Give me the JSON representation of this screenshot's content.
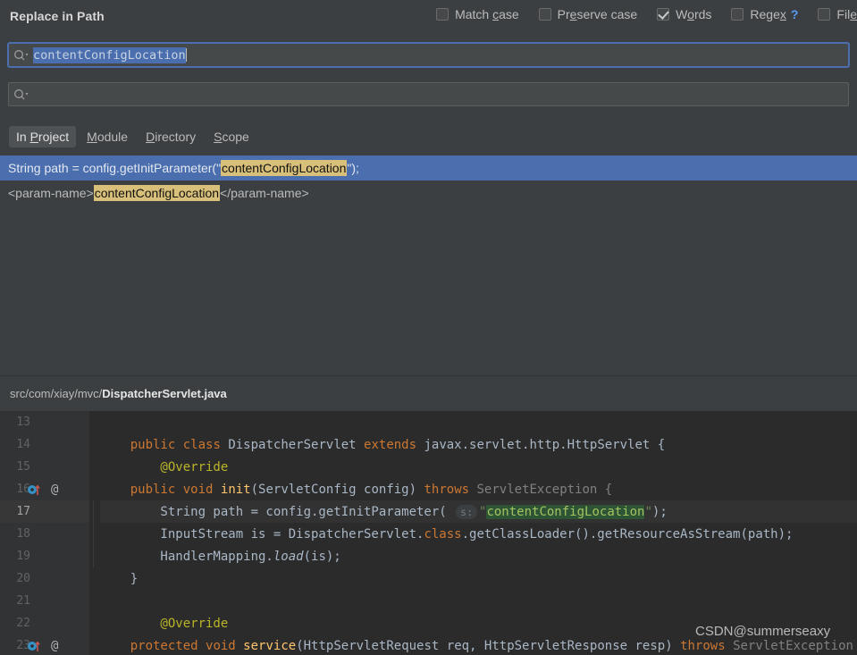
{
  "dialog": {
    "title": "Replace in Path"
  },
  "options": [
    {
      "id": "match-case",
      "label_pre": "Match ",
      "label_mn": "c",
      "label_post": "ase",
      "checked": false,
      "help": null
    },
    {
      "id": "preserve-case",
      "label_pre": "Pr",
      "label_mn": "e",
      "label_post": "serve case",
      "checked": false,
      "help": null
    },
    {
      "id": "words",
      "label_pre": "W",
      "label_mn": "o",
      "label_post": "rds",
      "checked": true,
      "help": null
    },
    {
      "id": "regex",
      "label_pre": "Rege",
      "label_mn": "x",
      "label_post": "",
      "checked": false,
      "help": "?"
    },
    {
      "id": "file-mask",
      "label_pre": "Fil",
      "label_mn": "e",
      "label_post": "",
      "checked": false,
      "help": null
    }
  ],
  "search_field": {
    "value": "contentConfigLocation",
    "placeholder": "",
    "icon": "search-icon",
    "selected": true
  },
  "replace_field": {
    "value": "",
    "placeholder": "",
    "icon": "search-icon"
  },
  "scopes": [
    {
      "id": "in-project",
      "pre": "In ",
      "mn": "P",
      "post": "roject",
      "active": true
    },
    {
      "id": "module",
      "pre": "",
      "mn": "M",
      "post": "odule",
      "active": false
    },
    {
      "id": "directory",
      "pre": "",
      "mn": "D",
      "post": "irectory",
      "active": false
    },
    {
      "id": "scope",
      "pre": "",
      "mn": "S",
      "post": "cope",
      "active": false
    }
  ],
  "results": [
    {
      "selected": true,
      "before": "String path = config.getInitParameter(\"",
      "match": "contentConfigLocation",
      "after": "\");"
    },
    {
      "selected": false,
      "before": "<param-name>",
      "match": "contentConfigLocation",
      "after": "</param-name>"
    }
  ],
  "file_path": {
    "dir": "src/com/xiay/mvc/",
    "file": "DispatcherServlet.java"
  },
  "editor": {
    "lines": [
      {
        "num": "13",
        "current": false,
        "marker": false,
        "fold": false
      },
      {
        "num": "14",
        "current": false,
        "marker": false,
        "fold": false
      },
      {
        "num": "15",
        "current": false,
        "marker": false,
        "fold": false
      },
      {
        "num": "16",
        "current": false,
        "marker": true,
        "fold": false
      },
      {
        "num": "17",
        "current": true,
        "marker": false,
        "fold": true
      },
      {
        "num": "18",
        "current": false,
        "marker": false,
        "fold": true
      },
      {
        "num": "19",
        "current": false,
        "marker": false,
        "fold": true
      },
      {
        "num": "20",
        "current": false,
        "marker": false,
        "fold": false
      },
      {
        "num": "21",
        "current": false,
        "marker": false,
        "fold": false
      },
      {
        "num": "22",
        "current": false,
        "marker": false,
        "fold": false
      },
      {
        "num": "23",
        "current": false,
        "marker": true,
        "fold": false
      }
    ],
    "code_text": {
      "l14": "public class DispatcherServlet extends javax.servlet.http.HttpServlet {",
      "l15": "@Override",
      "l16": "public void init(ServletConfig config) throws ServletException {",
      "l17_pre": "String path = config.getInitParameter( ",
      "l17_hint": "s:",
      "l17_match": "contentConfigLocation",
      "l17_post": "\");",
      "l18": "InputStream is = DispatcherServlet.class.getClassLoader().getResourceAsStream(path);",
      "l19": "HandlerMapping.load(is);",
      "l20": "}",
      "l22": "@Override",
      "l23": "protected void service(HttpServletRequest req, HttpServletResponse resp) throws ServletException"
    },
    "marker_icon": "override-method-icon",
    "annotation_icon": "annotation-at-icon"
  },
  "watermark": {
    "text": "CSDN@summerseaxy"
  },
  "colors": {
    "panel_bg": "#3c3f41",
    "editor_bg": "#2b2b2b",
    "selection_blue": "#4b6eaf",
    "match_yellow": "#d9c07a",
    "code_match_green": "#2d5434",
    "keyword_orange": "#cc7832",
    "method_yellow": "#ffc66d",
    "annotation_olive": "#bbb529",
    "link_blue": "#589df6"
  }
}
